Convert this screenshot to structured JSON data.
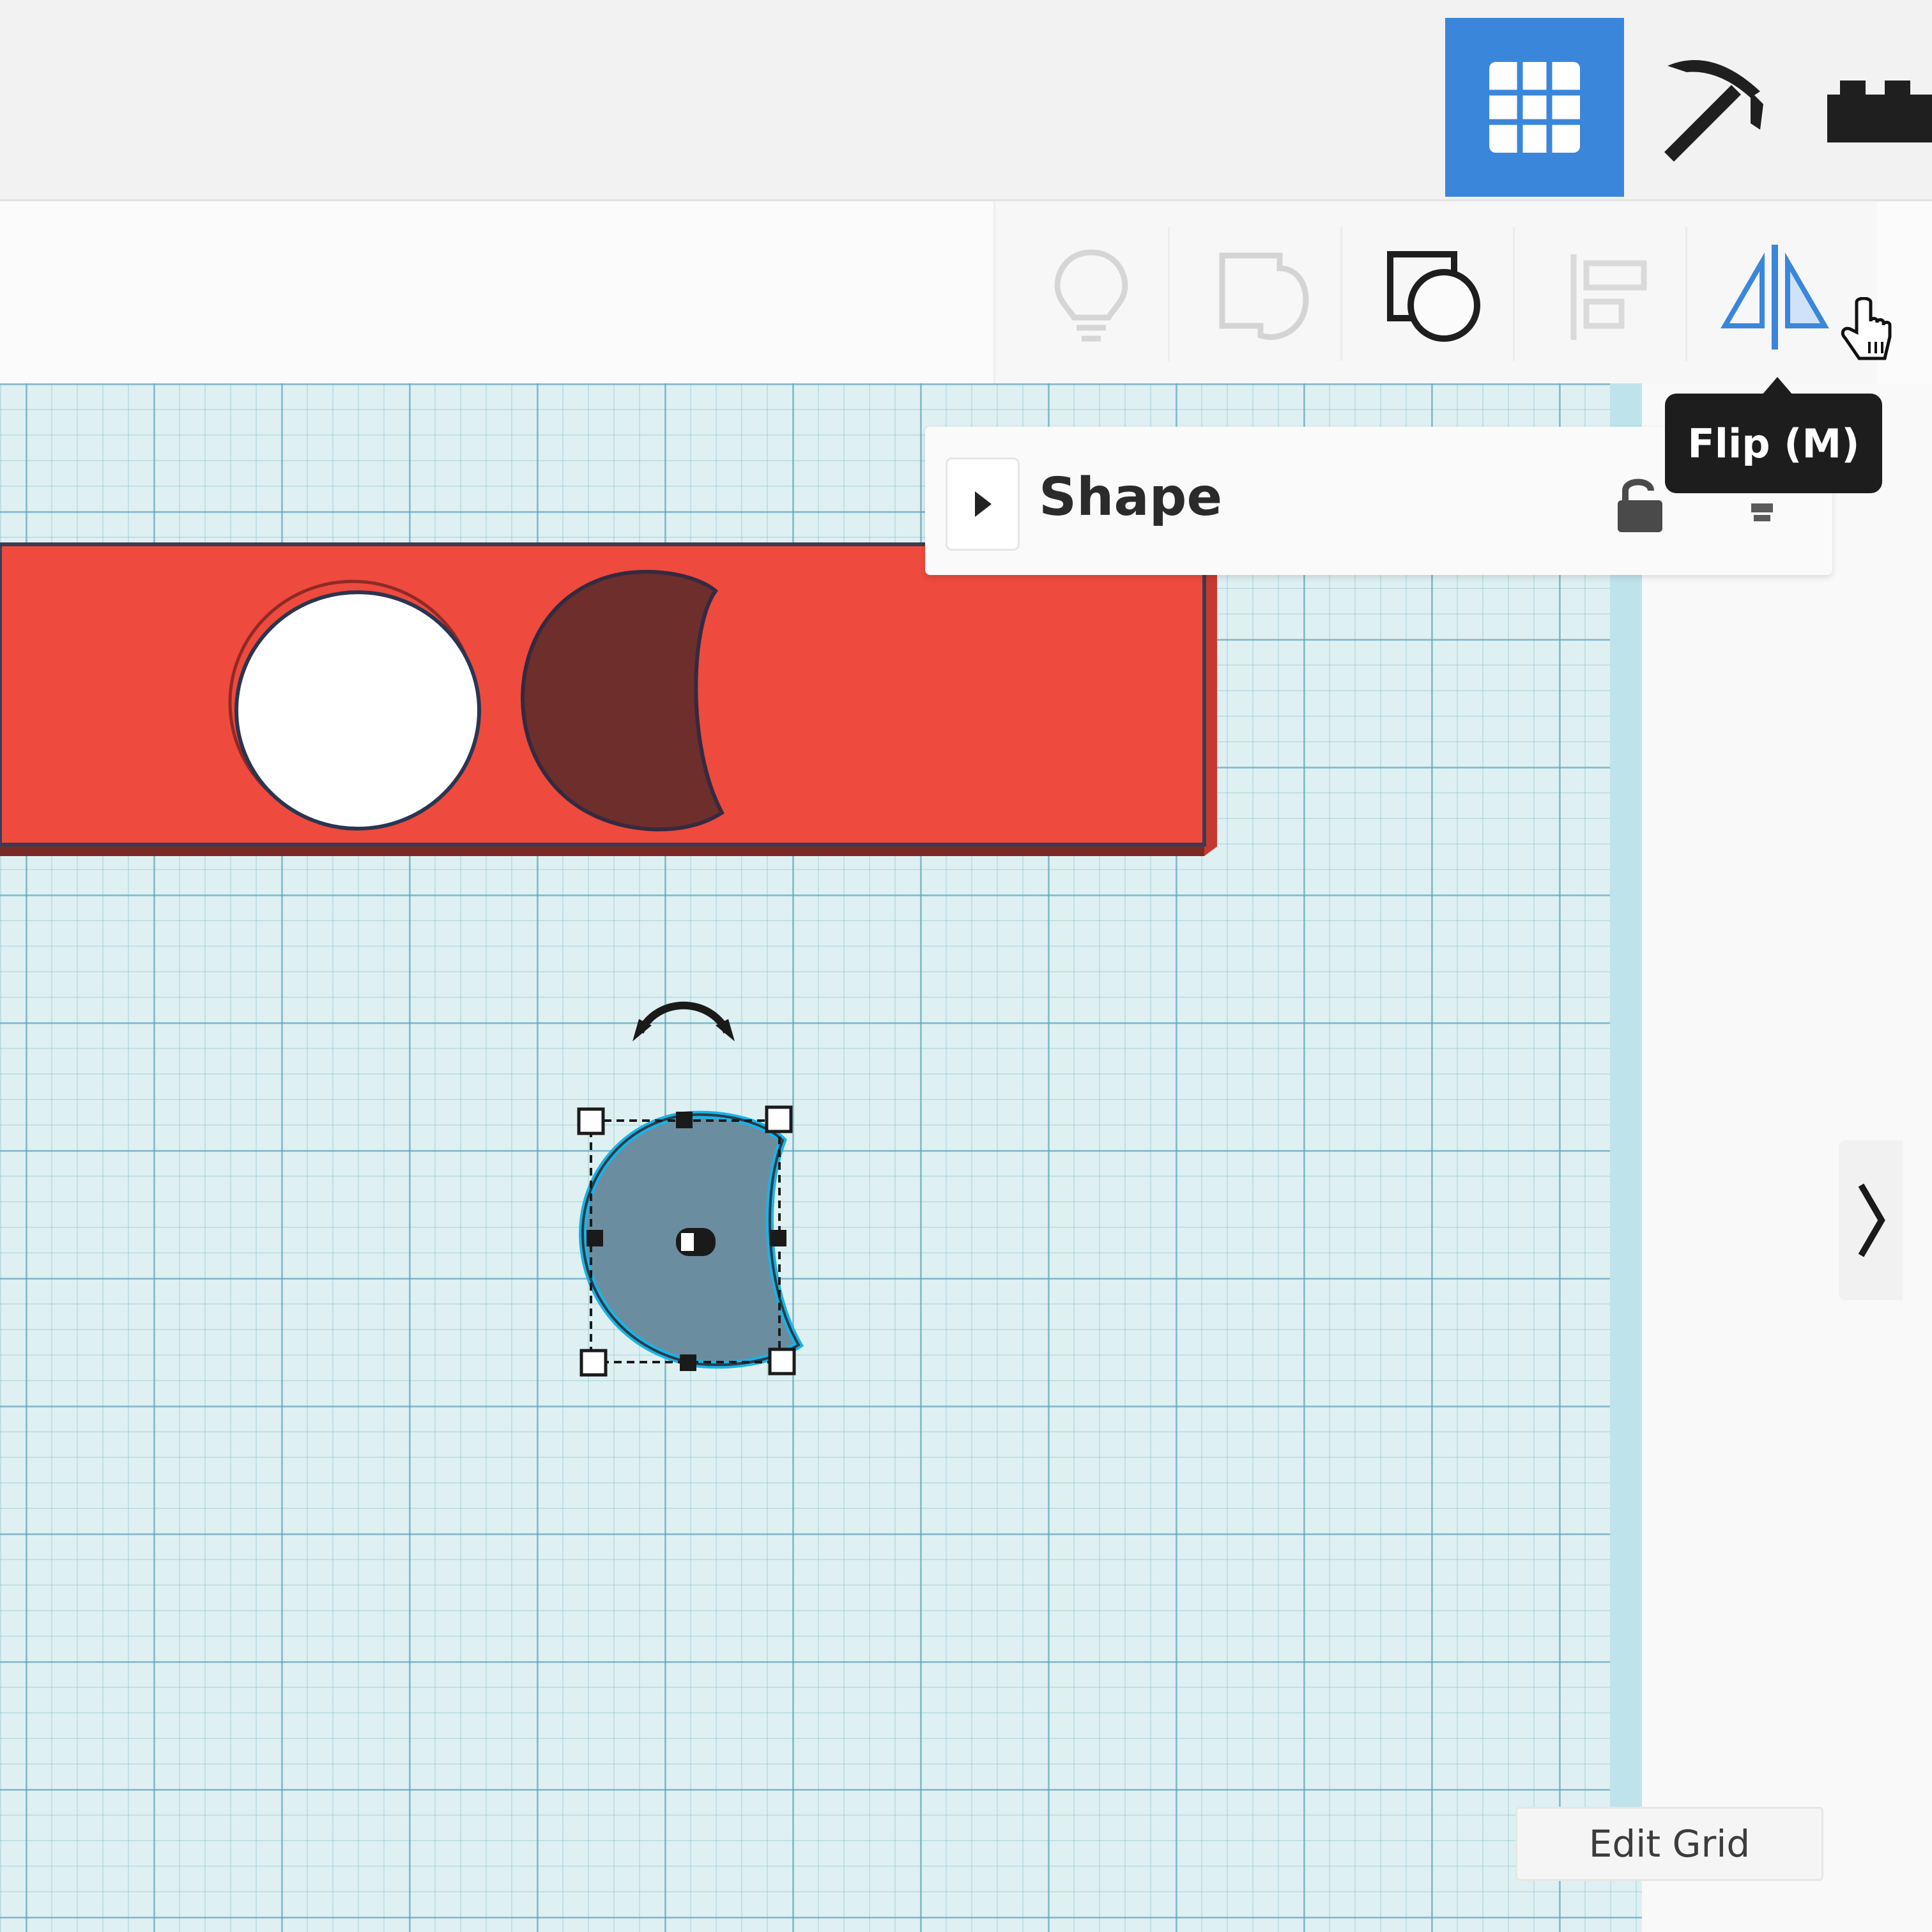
{
  "header": {
    "views": [
      {
        "name": "3D Design",
        "icon": "grid-icon",
        "active": true
      },
      {
        "name": "Blocks",
        "icon": "pickaxe-icon",
        "active": false
      },
      {
        "name": "Bricks",
        "icon": "brick-icon",
        "active": false
      }
    ]
  },
  "toolbar": {
    "tools": [
      {
        "icon": "lightbulb-icon",
        "enabled": false
      },
      {
        "icon": "ungroup-icon",
        "enabled": false
      },
      {
        "icon": "group-icon",
        "enabled": true
      },
      {
        "icon": "align-icon",
        "enabled": false
      },
      {
        "icon": "flip-icon",
        "enabled": true,
        "hovered": true
      }
    ],
    "tooltip": "Flip (M)"
  },
  "inspector": {
    "title": "Shape",
    "icons": [
      "lock-icon",
      "light-icon"
    ]
  },
  "canvas": {
    "objects": [
      {
        "name": "red-box",
        "color": "#ee4a3d"
      },
      {
        "name": "cylinder-hole",
        "color": "#ffffff"
      },
      {
        "name": "moon-hole",
        "color": "#6d2e2c"
      },
      {
        "name": "selected-moon",
        "color": "#6b8da0",
        "selected": true
      }
    ]
  },
  "footer": {
    "edit_grid_label": "Edit Grid"
  },
  "colors": {
    "accent": "#3a86db",
    "selection": "#19b4e6",
    "tooltip_bg": "#1d1d1d"
  }
}
